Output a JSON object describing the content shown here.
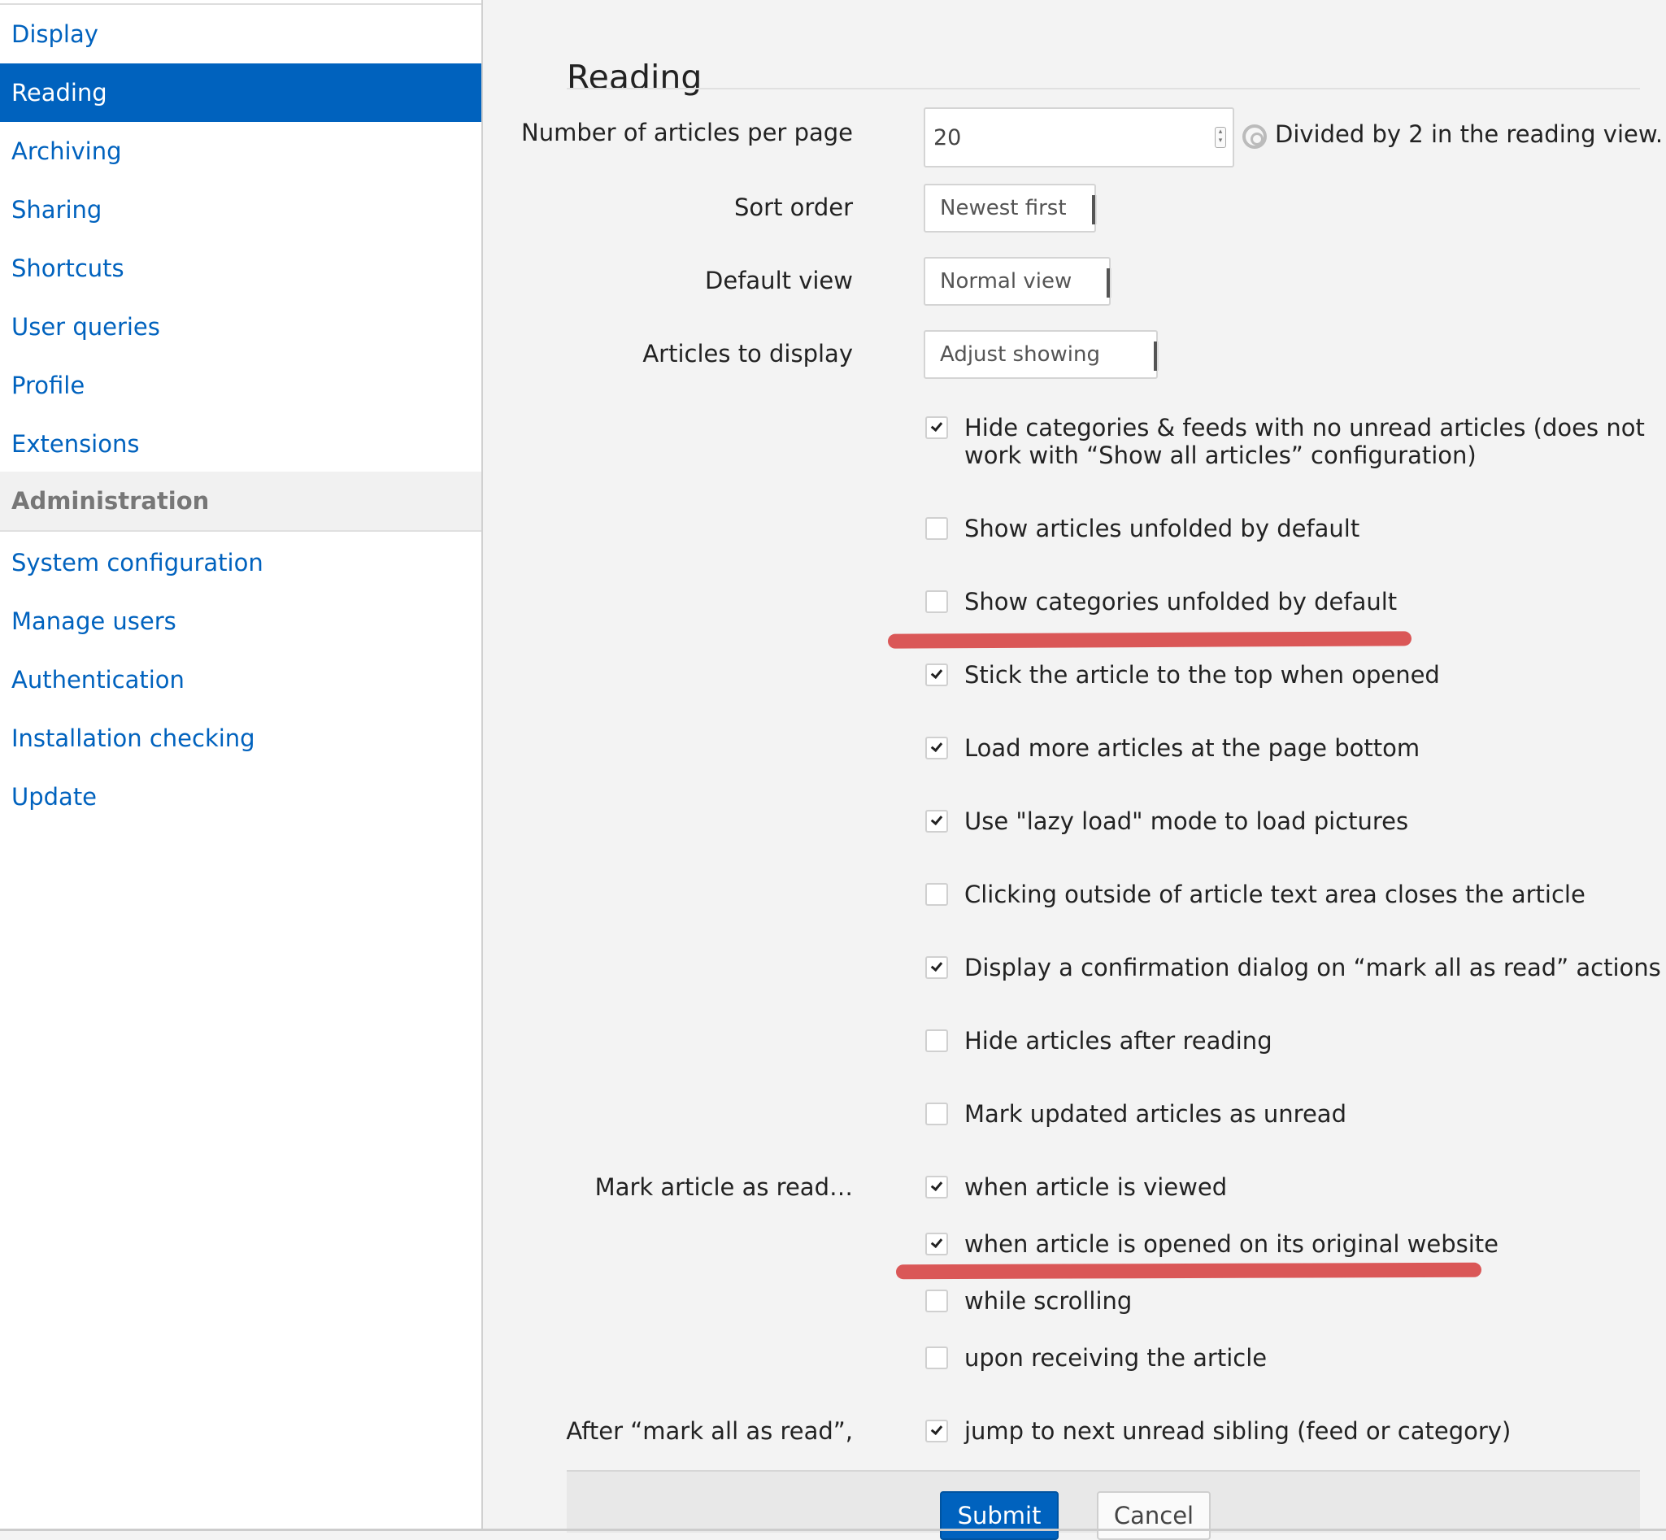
{
  "sidebar": {
    "items": [
      {
        "label": "Display",
        "active": false
      },
      {
        "label": "Reading",
        "active": true
      },
      {
        "label": "Archiving",
        "active": false
      },
      {
        "label": "Sharing",
        "active": false
      },
      {
        "label": "Shortcuts",
        "active": false
      },
      {
        "label": "User queries",
        "active": false
      },
      {
        "label": "Profile",
        "active": false
      },
      {
        "label": "Extensions",
        "active": false
      }
    ],
    "admin_section": "Administration",
    "admin_items": [
      {
        "label": "System configuration"
      },
      {
        "label": "Manage users"
      },
      {
        "label": "Authentication"
      },
      {
        "label": "Installation checking"
      },
      {
        "label": "Update"
      }
    ]
  },
  "main": {
    "title": "Reading",
    "articles_per_page": {
      "label": "Number of articles per page",
      "value": "20",
      "help": "Divided by 2 in the reading view."
    },
    "sort_order": {
      "label": "Sort order",
      "value": "Newest first"
    },
    "default_view": {
      "label": "Default view",
      "value": "Normal view"
    },
    "articles_to_display": {
      "label": "Articles to display",
      "value": "Adjust showing"
    },
    "options": [
      {
        "label": "Hide categories & feeds with no unread articles (does not work with “Show all articles” configuration)",
        "checked": true
      },
      {
        "label": "Show articles unfolded by default",
        "checked": false
      },
      {
        "label": "Show categories unfolded by default",
        "checked": false
      },
      {
        "label": "Stick the article to the top when opened",
        "checked": true
      },
      {
        "label": "Load more articles at the page bottom",
        "checked": true
      },
      {
        "label": "Use \"lazy load\" mode to load pictures",
        "checked": true
      },
      {
        "label": "Clicking outside of article text area closes the article",
        "checked": false
      },
      {
        "label": "Display a confirmation dialog on “mark all as read” actions",
        "checked": true
      },
      {
        "label": "Hide articles after reading",
        "checked": false
      },
      {
        "label": "Mark updated articles as unread",
        "checked": false
      }
    ],
    "mark_as_read": {
      "label": "Mark article as read…",
      "options": [
        {
          "label": "when article is viewed",
          "checked": true
        },
        {
          "label": "when article is opened on its original website",
          "checked": true
        },
        {
          "label": "while scrolling",
          "checked": false
        },
        {
          "label": "upon receiving the article",
          "checked": false
        }
      ]
    },
    "after_mark_all": {
      "label": "After “mark all as read”,",
      "option": {
        "label": "jump to next unread sibling (feed or category)",
        "checked": true
      }
    },
    "buttons": {
      "submit": "Submit",
      "cancel": "Cancel"
    }
  },
  "colors": {
    "accent": "#0062be",
    "annotation": "#d84a4a"
  }
}
